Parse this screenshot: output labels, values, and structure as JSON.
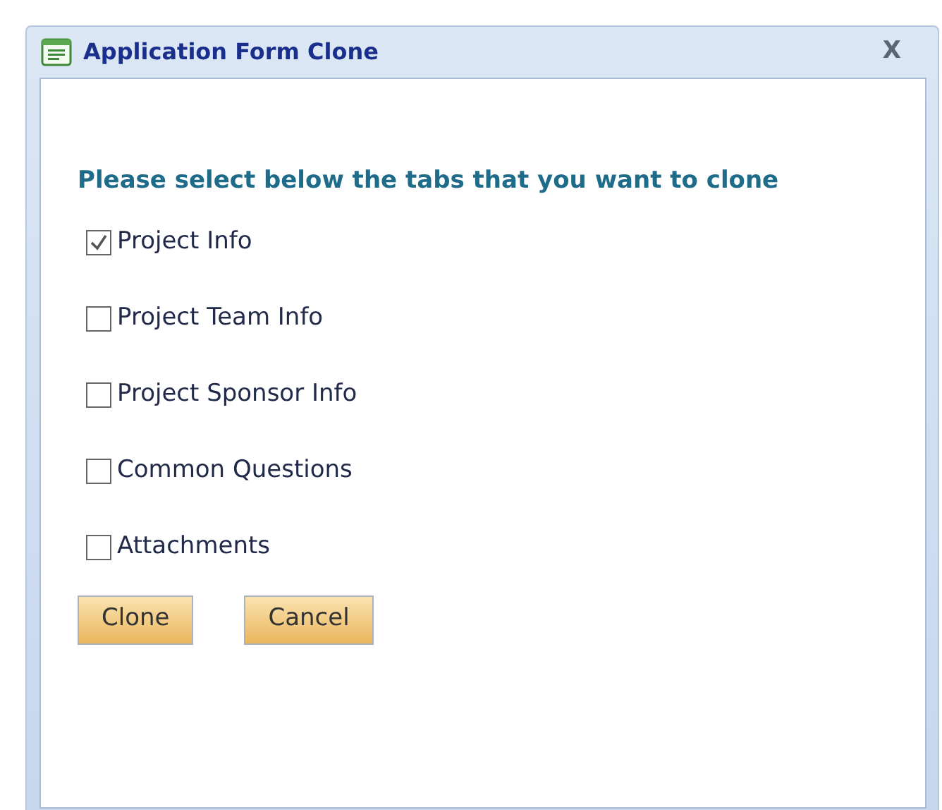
{
  "window": {
    "title": "Application Form Clone",
    "close": "X"
  },
  "prompt": "Please select below the tabs that you want to clone",
  "options": [
    {
      "label": "Project Info",
      "checked": true
    },
    {
      "label": "Project Team Info",
      "checked": false
    },
    {
      "label": "Project Sponsor Info",
      "checked": false
    },
    {
      "label": "Common Questions",
      "checked": false
    },
    {
      "label": "Attachments",
      "checked": false
    }
  ],
  "buttons": [
    "Clone",
    "Cancel"
  ]
}
